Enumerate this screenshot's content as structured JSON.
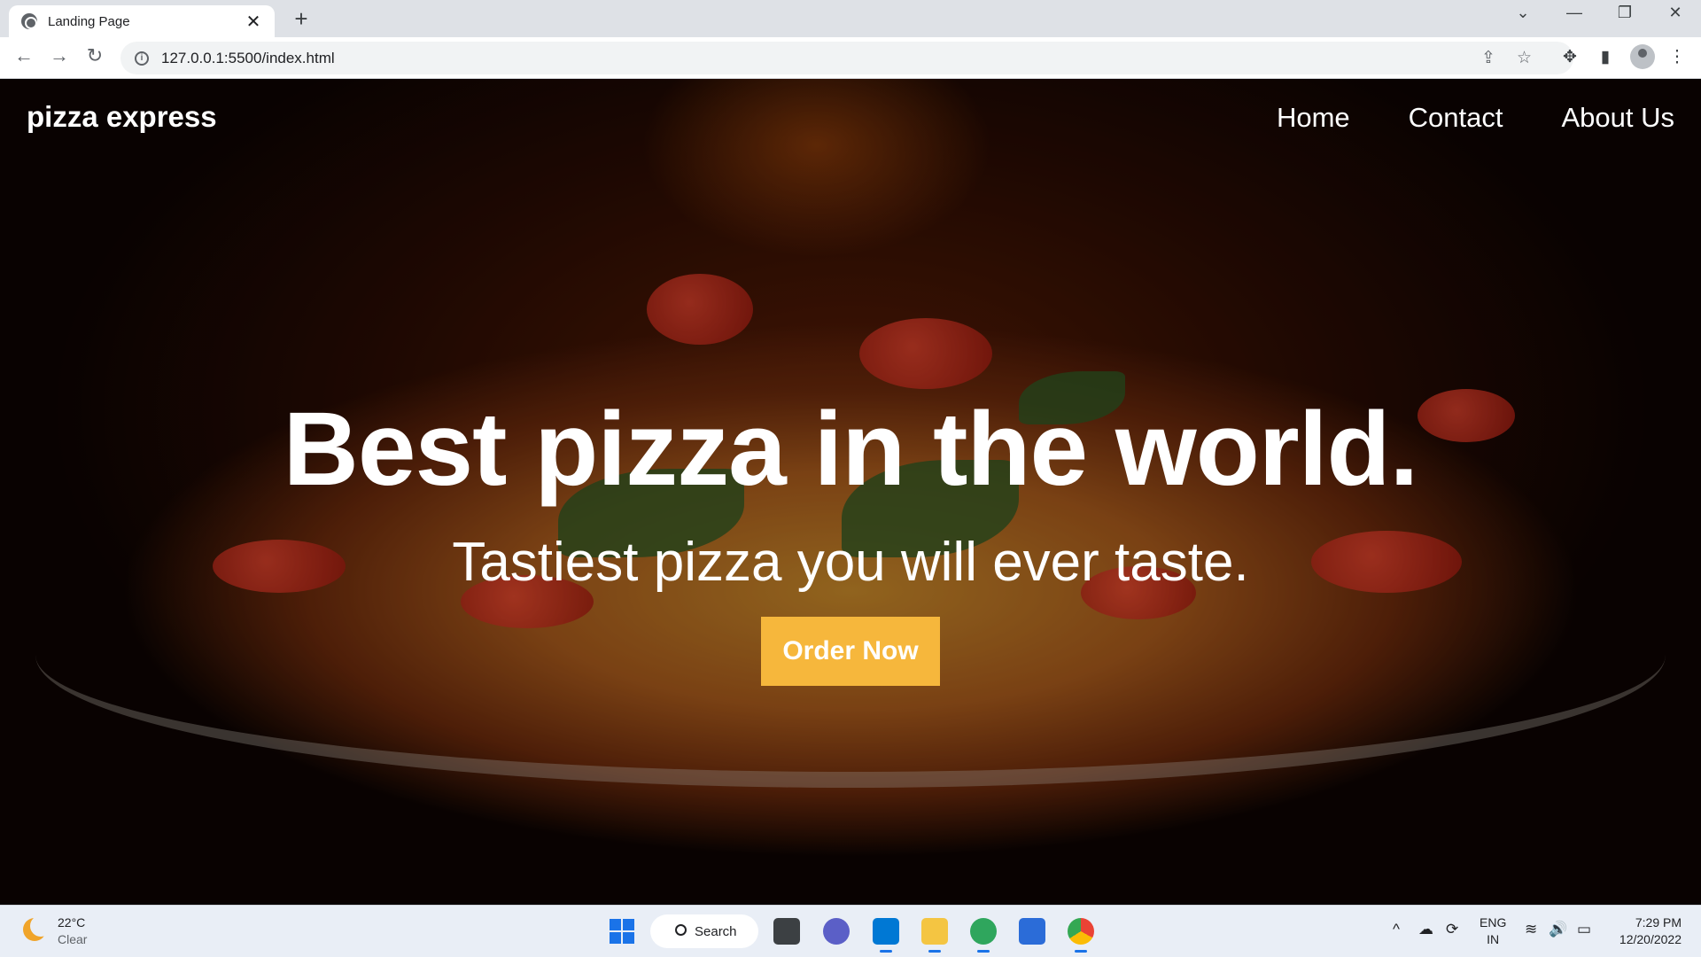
{
  "browser": {
    "tab_title": "Landing Page",
    "tab_close": "✕",
    "new_tab": "+",
    "url": "127.0.0.1:5500/index.html",
    "window_controls": {
      "dropdown": "⌄",
      "minimize": "—",
      "restore": "❐",
      "close": "✕"
    },
    "nav": {
      "back": "←",
      "forward": "→",
      "reload": "↻"
    },
    "toolbar_icons": {
      "share": "⇪",
      "bookmark": "☆",
      "extensions": "✥",
      "sidepanel": "▮",
      "menu": "⋮"
    }
  },
  "site": {
    "brand": "pizza express",
    "nav_items": [
      "Home",
      "Contact",
      "About Us"
    ],
    "headline": "Best pizza in the world.",
    "subheadline": "Tastiest pizza you will ever taste.",
    "cta": "Order Now",
    "accent_color": "#f6b73c"
  },
  "taskbar": {
    "weather_temp": "22°C",
    "weather_cond": "Clear",
    "search_label": "Search",
    "lang_top": "ENG",
    "lang_bottom": "IN",
    "time": "7:29 PM",
    "date": "12/20/2022",
    "tray_icons": {
      "chevron": "^",
      "cloud": "☁",
      "sync": "⟳",
      "wifi": "≋",
      "volume": "🔊",
      "battery": "▭"
    }
  }
}
